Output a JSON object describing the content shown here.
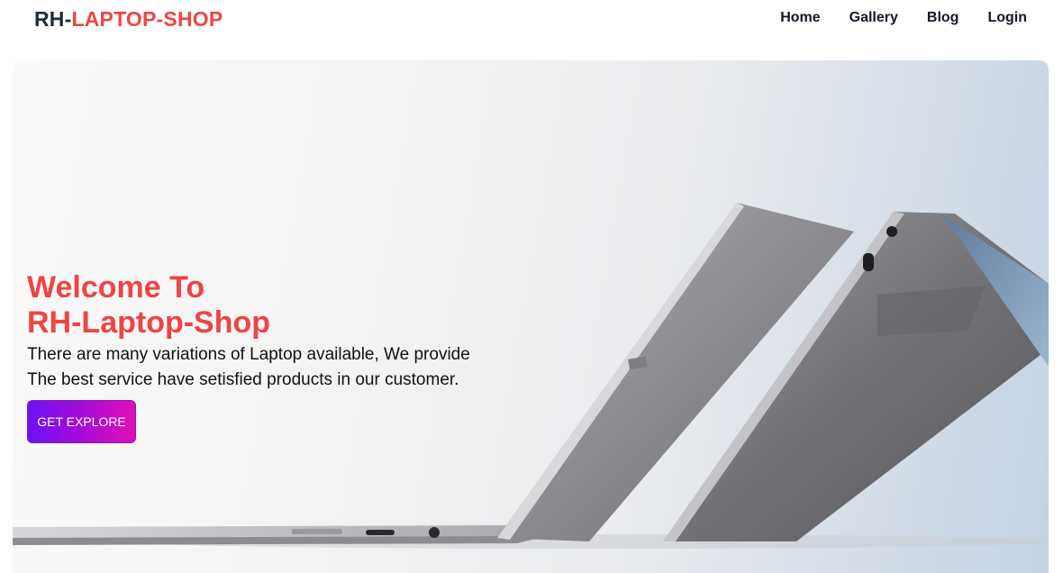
{
  "header": {
    "logo_prefix": "RH-",
    "logo_suffix": "LAPTOP-SHOP",
    "nav": [
      "Home",
      "Gallery",
      "Blog",
      "Login"
    ]
  },
  "hero": {
    "title_line1": "Welcome To",
    "title_line2": "RH-Laptop-Shop",
    "description_line1": "There are many variations of Laptop available, We provide",
    "description_line2": "The best service have setisfied products in our customer.",
    "button_label": "GET EXPLORE",
    "image_subject": "laptop-image"
  },
  "colors": {
    "brand_red": "#ef4444",
    "text_dark": "#1f2937",
    "button_gradient_start": "#6c12f2",
    "button_gradient_end": "#e20fb6"
  }
}
